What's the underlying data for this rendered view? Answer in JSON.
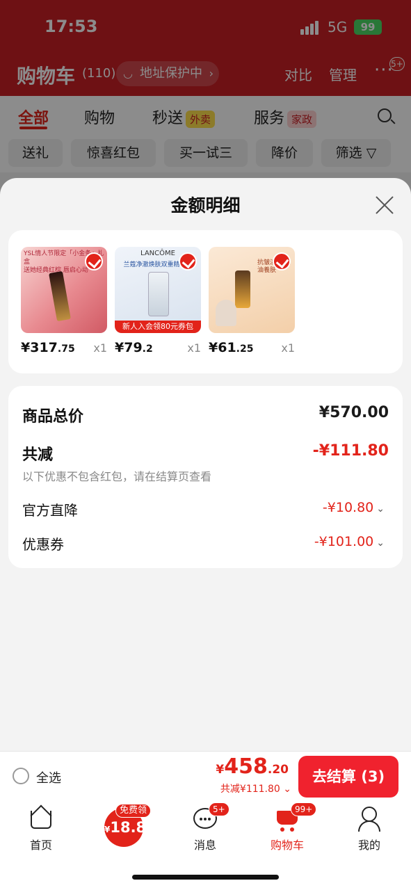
{
  "status_bar": {
    "time": "17:53",
    "network": "5G",
    "battery": "99"
  },
  "background": {
    "title": "购物车",
    "count": "(110)",
    "address_protect": "地址保护中",
    "compare": "对比",
    "manage": "管理",
    "more_badge": "5+",
    "tabs": [
      {
        "label": "全部",
        "tag": ""
      },
      {
        "label": "购物",
        "tag": ""
      },
      {
        "label": "秒送",
        "tag": "外卖"
      },
      {
        "label": "服务",
        "tag": "家政"
      }
    ],
    "chips": [
      "送礼",
      "惊喜红包",
      "买一试三",
      "降价",
      "筛选"
    ]
  },
  "sheet": {
    "title": "金额明细",
    "products": [
      {
        "caption": "YSL情人节限定「小金条」礼盒",
        "caption2": "送她经典红棕 唇启心动",
        "price_int": "¥317",
        "price_frac": ".75",
        "qty": "x1",
        "promo": ""
      },
      {
        "caption": "兰蔻净澈焕肤双重精华水",
        "caption2": "",
        "price_int": "¥79",
        "price_frac": ".2",
        "qty": "x1",
        "promo": "新人入会领80元券包",
        "brand": "LANCÔME"
      },
      {
        "caption": "抗皱淡纹 以油養肤",
        "caption2": "",
        "price_int": "¥61",
        "price_frac": ".25",
        "qty": "x1",
        "promo": ""
      }
    ],
    "rows": {
      "total_label": "商品总价",
      "total_value": "¥570.00",
      "reduce_label": "共减",
      "reduce_value": "-¥111.80",
      "reduce_note": "以下优惠不包含红包，请在结算页查看",
      "official_label": "官方直降",
      "official_value": "-¥10.80",
      "coupon_label": "优惠券",
      "coupon_value": "-¥101.00"
    }
  },
  "checkout": {
    "select_all": "全选",
    "currency": "¥",
    "total_int": "458",
    "total_frac": ".20",
    "reduce_text": "共减¥111.80",
    "button": "去结算 (3)"
  },
  "tabbar": {
    "items": [
      {
        "label": "首页",
        "badge": ""
      },
      {
        "label": "",
        "badge": "免费领",
        "coin": "18.8"
      },
      {
        "label": "消息",
        "badge": "5+"
      },
      {
        "label": "购物车",
        "badge": "99+"
      },
      {
        "label": "我的",
        "badge": ""
      }
    ]
  }
}
